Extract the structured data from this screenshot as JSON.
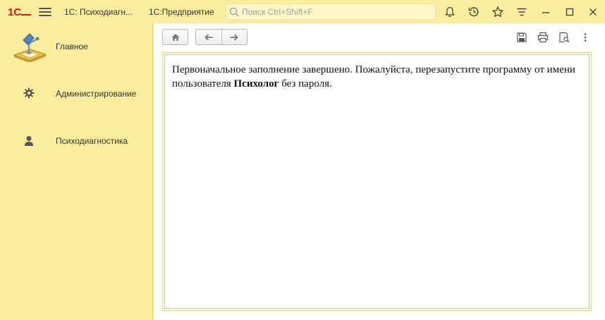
{
  "titlebar": {
    "logo_text": "1С",
    "app_title": "1С: Психодиагн...",
    "platform": "1С:Предприятие",
    "search_placeholder": "Поиск Ctrl+Shift+F"
  },
  "sidebar": {
    "items": [
      {
        "label": "Главное",
        "icon": "desk-lamp-icon"
      },
      {
        "label": "Администрирование",
        "icon": "gear-icon"
      },
      {
        "label": "Психодиагностика",
        "icon": "person-icon"
      }
    ]
  },
  "main": {
    "message": {
      "part1": "Первоначальное заполнение завершено. Пожалуйста, перезапустите программу от имени пользователя ",
      "bold": "Психолог",
      "part2": " без пароля."
    }
  },
  "colors": {
    "panel": "#fbed9e",
    "accent_red": "#d4190b",
    "frame_border": "#e3d27f"
  }
}
